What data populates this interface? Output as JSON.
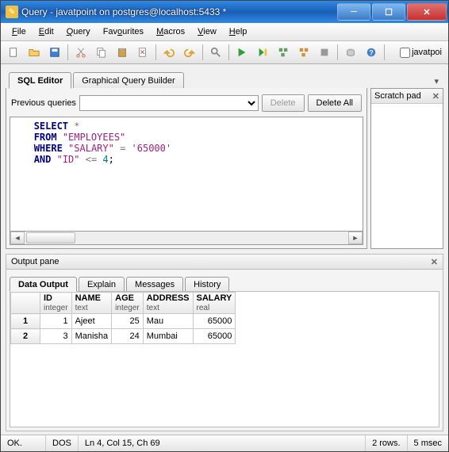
{
  "window": {
    "title": "Query - javatpoint on postgres@localhost:5433 *"
  },
  "menu": {
    "file": "File",
    "edit": "Edit",
    "query": "Query",
    "favourites": "Favourites",
    "macros": "Macros",
    "view": "View",
    "help": "Help"
  },
  "toolbar_check_label": "javatpoi",
  "tabs": {
    "sql": "SQL Editor",
    "gqb": "Graphical Query Builder"
  },
  "scratch": {
    "title": "Scratch pad"
  },
  "prev": {
    "label": "Previous queries",
    "delete": "Delete",
    "delete_all": "Delete All"
  },
  "sql": {
    "l1a": "SELECT",
    "l1b": " *",
    "l2a": "FROM ",
    "l2b": "\"EMPLOYEES\"",
    "l3a": "WHERE ",
    "l3b": "\"SALARY\"",
    "l3c": " = ",
    "l3d": "'65000'",
    "l4a": "AND ",
    "l4b": "\"ID\"",
    "l4c": " <= ",
    "l4d": "4",
    "l4e": ";"
  },
  "output": {
    "title": "Output pane",
    "tabs": {
      "data": "Data Output",
      "explain": "Explain",
      "messages": "Messages",
      "history": "History"
    }
  },
  "cols": {
    "id": {
      "n": "ID",
      "t": "integer"
    },
    "name": {
      "n": "NAME",
      "t": "text"
    },
    "age": {
      "n": "AGE",
      "t": "integer"
    },
    "address": {
      "n": "ADDRESS",
      "t": "text"
    },
    "salary": {
      "n": "SALARY",
      "t": "real"
    }
  },
  "rows": [
    {
      "num": "1",
      "id": "1",
      "name": "Ajeet",
      "age": "25",
      "address": "Mau",
      "salary": "65000"
    },
    {
      "num": "2",
      "id": "3",
      "name": "Manisha",
      "age": "24",
      "address": "Mumbai",
      "salary": "65000"
    }
  ],
  "status": {
    "ok": "OK.",
    "enc": "DOS",
    "pos": "Ln 4, Col 15, Ch 69",
    "rows": "2 rows.",
    "time": "5 msec"
  }
}
